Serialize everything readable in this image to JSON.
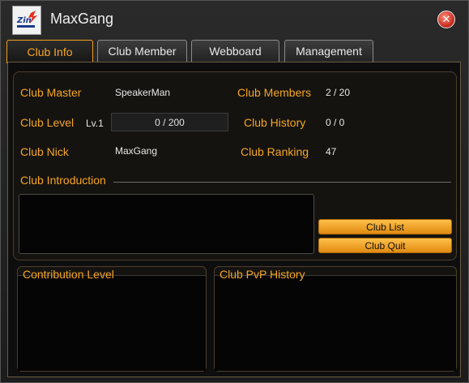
{
  "window": {
    "title": "MaxGang"
  },
  "tabs": [
    "Club Info",
    "Club Member",
    "Webboard",
    "Management"
  ],
  "club_info": {
    "master_label": "Club Master",
    "master_value": "SpeakerMan",
    "level_label": "Club Level",
    "level_value": "Lv.1",
    "level_progress": "0 / 200",
    "nick_label": "Club Nick",
    "nick_value": "MaxGang",
    "members_label": "Club Members",
    "members_value": "2 / 20",
    "history_label": "Club History",
    "history_value": "0 / 0",
    "ranking_label": "Club Ranking",
    "ranking_value": "47",
    "intro_label": "Club Introduction"
  },
  "buttons": {
    "club_list": "Club List",
    "club_quit": "Club Quit"
  },
  "sections": {
    "contribution": "Contribution Level",
    "pvp_history": "Club PvP History"
  },
  "colors": {
    "accent": "#f5a623",
    "close": "#c0281a"
  }
}
